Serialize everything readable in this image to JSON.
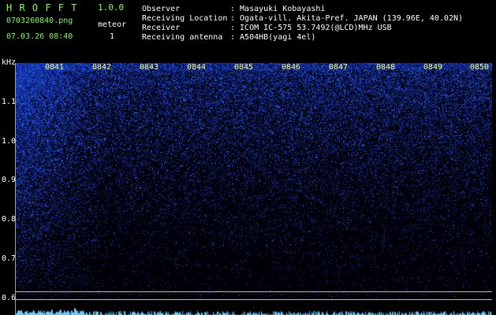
{
  "app": {
    "title": "H R O F F T",
    "version": "1.0.0"
  },
  "file": {
    "name": "0703260840.png",
    "datetime": "07.03.26 08:40"
  },
  "meteor": {
    "label": "meteor",
    "count": "1"
  },
  "info": {
    "rows": [
      {
        "label": "Observer",
        "value": ": Masayuki Kobayashi"
      },
      {
        "label": "Receiving Location",
        "value": ": Ogata-vill. Akita-Pref. JAPAN (139.96E, 40.02N)"
      },
      {
        "label": "Receiver",
        "value": ": ICOM IC-575 53.7492(@LCD)MHz USB"
      },
      {
        "label": "Receiving antenna",
        "value": ": A504HB(yagi 4el)"
      }
    ]
  },
  "axis": {
    "unit": "kHz",
    "y_ticks": [
      "1.1",
      "1.0",
      "0.9",
      "0.8",
      "0.7",
      "0.6"
    ],
    "x_ticks": [
      "0841",
      "0842",
      "0843",
      "0844",
      "0845",
      "0846",
      "0847",
      "0848",
      "0849",
      "0850"
    ]
  },
  "colors": {
    "title": "#7cff4c",
    "text": "#ffffff",
    "time_label": "#ffff66",
    "signal": "#3050ff",
    "background": "#000000"
  }
}
